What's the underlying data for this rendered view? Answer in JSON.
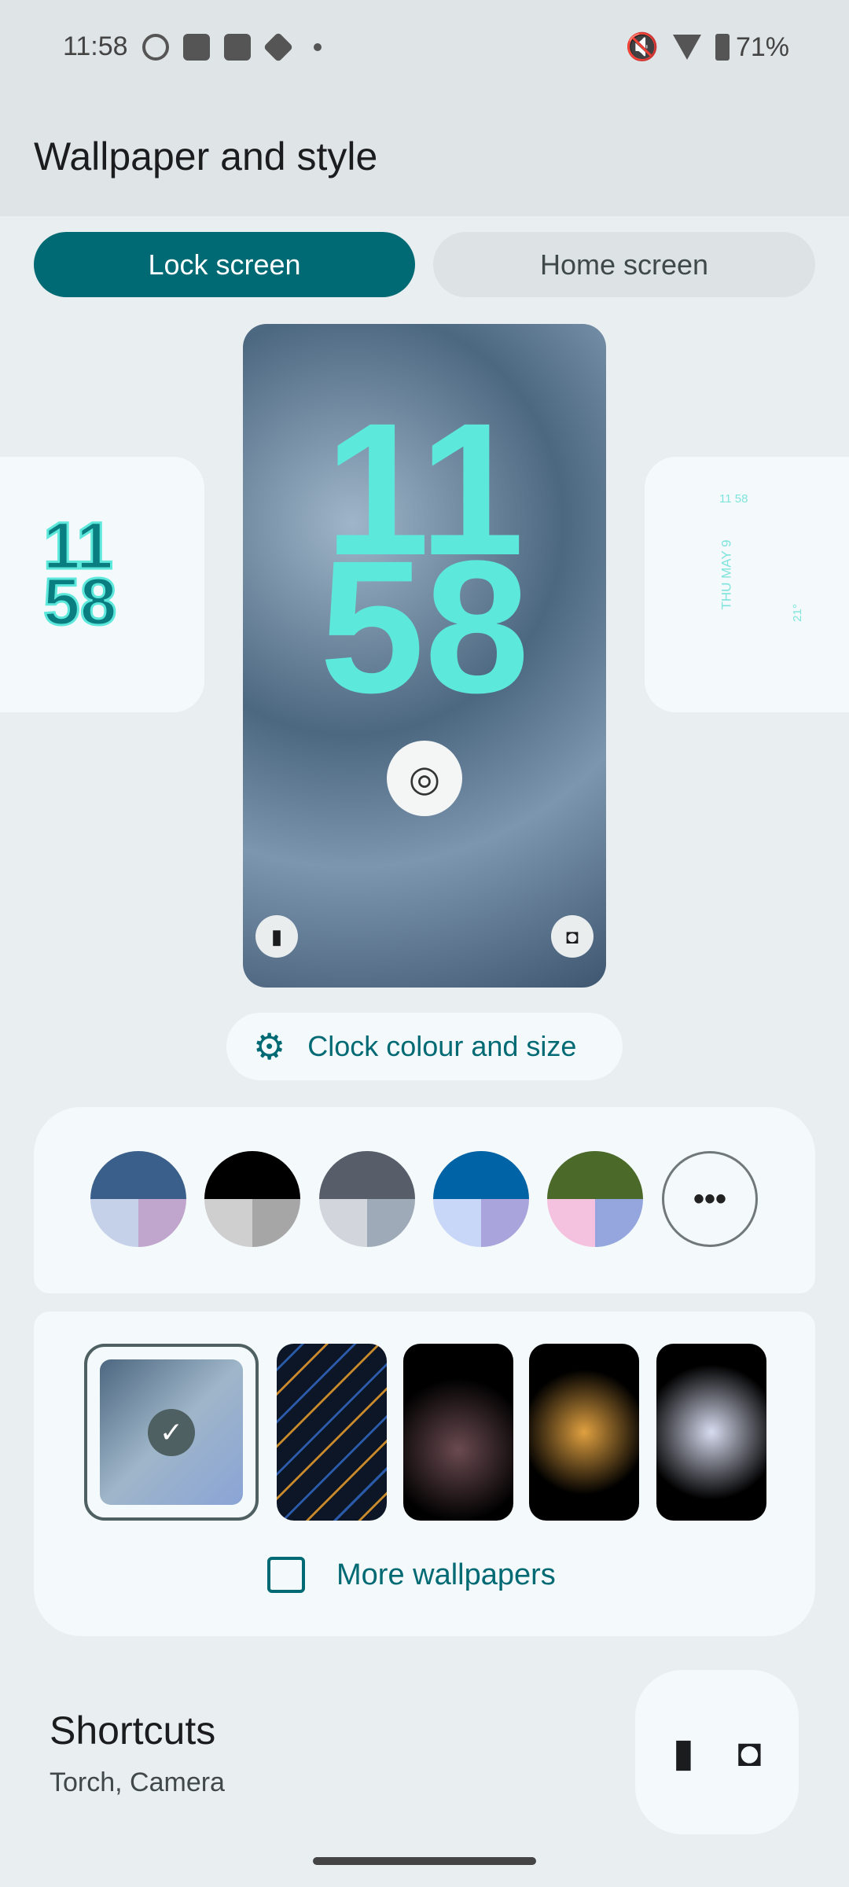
{
  "status_bar": {
    "time": "11:58",
    "notification_icons": [
      "whatsapp-icon",
      "youtube-icon",
      "outlook-icon",
      "package-icon",
      "dot-icon"
    ],
    "system_icons": [
      "mute-icon",
      "wifi-icon",
      "battery-icon"
    ],
    "battery": "71%"
  },
  "header": {
    "title": "Wallpaper and style"
  },
  "tabs": [
    {
      "label": "Lock screen",
      "selected": true
    },
    {
      "label": "Home screen",
      "selected": false
    }
  ],
  "preview": {
    "clock_hours": "11",
    "clock_minutes": "58",
    "left_clock": "11\n58",
    "right_clock": {
      "time": "11 58",
      "date": "THU MAY 9",
      "temp": "21°"
    }
  },
  "clock_button": {
    "label": "Clock colour and size"
  },
  "colour_options": [
    {
      "top": "#3a5f8a",
      "bl": "#c5d1e8",
      "br": "#c0a5cc"
    },
    {
      "top": "#000000",
      "bl": "#cfcfcf",
      "br": "#a6a6a6"
    },
    {
      "top": "#575e6a",
      "bl": "#d3d5dd",
      "br": "#9eaab8"
    },
    {
      "top": "#0063a5",
      "bl": "#c8d6f8",
      "br": "#a9a4dc"
    },
    {
      "top": "#4b6a2a",
      "bl": "#f4c2de",
      "br": "#94a6dd"
    }
  ],
  "wallpapers": {
    "more_label": "More wallpapers",
    "selected_index": 0
  },
  "shortcuts": {
    "title": "Shortcuts",
    "subtitle": "Torch, Camera"
  },
  "colors": {
    "accent": "#006a74",
    "clock": "#5de8dc"
  }
}
